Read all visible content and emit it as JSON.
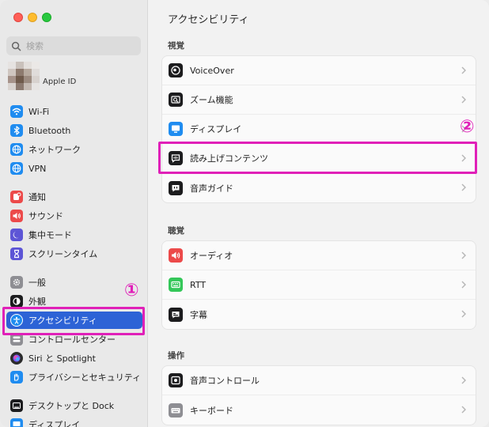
{
  "sidebar": {
    "search_placeholder": "検索",
    "apple_id_label": "Apple ID",
    "items": [
      {
        "label": "Wi-Fi",
        "icon": "wifi-icon",
        "color": "#1f8cf0"
      },
      {
        "label": "Bluetooth",
        "icon": "bluetooth-icon",
        "color": "#1f8cf0"
      },
      {
        "label": "ネットワーク",
        "icon": "globe-icon",
        "color": "#1f8cf0"
      },
      {
        "label": "VPN",
        "icon": "vpn-globe-icon",
        "color": "#1f8cf0"
      },
      {
        "label": "通知",
        "icon": "bell-icon",
        "color": "#ec4a4a"
      },
      {
        "label": "サウンド",
        "icon": "speaker-icon",
        "color": "#ec4a4a"
      },
      {
        "label": "集中モード",
        "icon": "moon-icon",
        "color": "#5d55d6"
      },
      {
        "label": "スクリーンタイム",
        "icon": "hourglass-icon",
        "color": "#5d55d6"
      },
      {
        "label": "一般",
        "icon": "gear-icon",
        "color": "#8e8e93"
      },
      {
        "label": "外観",
        "icon": "appearance-icon",
        "color": "#1c1c1e"
      },
      {
        "label": "アクセシビリティ",
        "icon": "accessibility-icon",
        "color": "#1f8cf0"
      },
      {
        "label": "コントロールセンター",
        "icon": "control-center-icon",
        "color": "#8e8e93"
      },
      {
        "label": "Siri と Spotlight",
        "icon": "siri-icon",
        "color": "#2b2b2b"
      },
      {
        "label": "プライバシーとセキュリティ",
        "icon": "hand-icon",
        "color": "#1f8cf0"
      },
      {
        "label": "デスクトップと Dock",
        "icon": "dock-icon",
        "color": "#1c1c1e"
      },
      {
        "label": "ディスプレイ",
        "icon": "display-icon",
        "color": "#1f8cf0"
      }
    ]
  },
  "main": {
    "title": "アクセシビリティ",
    "sections": [
      {
        "title": "視覚",
        "rows": [
          {
            "label": "VoiceOver",
            "icon": "voiceover-icon"
          },
          {
            "label": "ズーム機能",
            "icon": "zoom-icon"
          },
          {
            "label": "ディスプレイ",
            "icon": "display-icon"
          },
          {
            "label": "読み上げコンテンツ",
            "icon": "spoken-content-icon"
          },
          {
            "label": "音声ガイド",
            "icon": "audio-description-icon"
          }
        ]
      },
      {
        "title": "聴覚",
        "rows": [
          {
            "label": "オーディオ",
            "icon": "speaker-icon"
          },
          {
            "label": "RTT",
            "icon": "rtt-icon"
          },
          {
            "label": "字幕",
            "icon": "captions-icon"
          }
        ]
      },
      {
        "title": "操作",
        "rows": [
          {
            "label": "音声コントロール",
            "icon": "voice-control-icon"
          },
          {
            "label": "キーボード",
            "icon": "keyboard-icon"
          }
        ]
      }
    ]
  },
  "annotations": {
    "marker_1": "①",
    "marker_2": "②",
    "highlight_color": "#e020b8"
  }
}
